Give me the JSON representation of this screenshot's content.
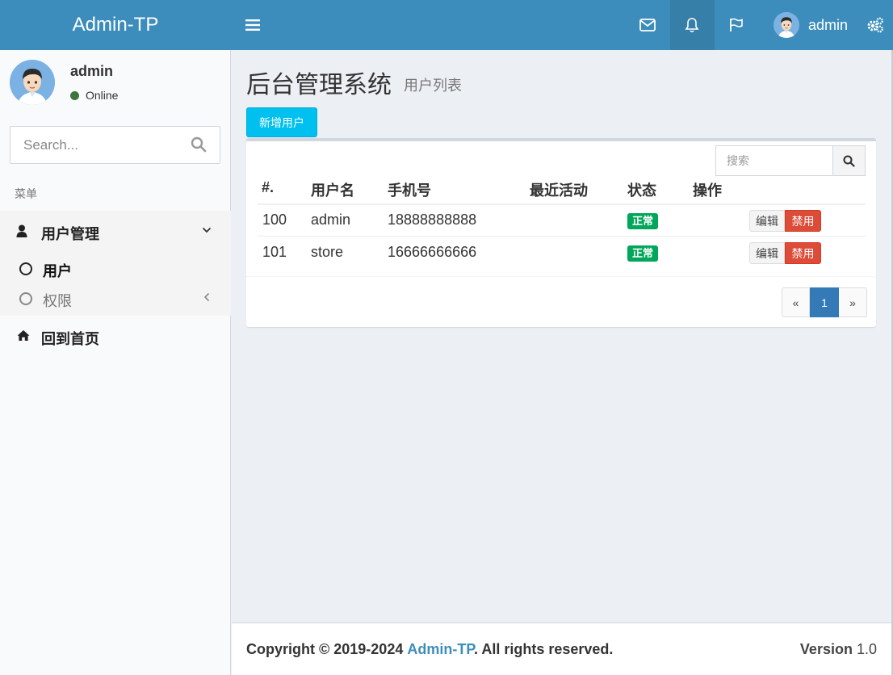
{
  "header": {
    "logo": "Admin-TP",
    "user_name": "admin"
  },
  "sidebar": {
    "user": {
      "name": "admin",
      "status": "Online"
    },
    "search_placeholder": "Search...",
    "menu_header": "菜单",
    "groups": [
      {
        "label": "用户管理",
        "items": [
          {
            "label": "用户"
          },
          {
            "label": "权限"
          }
        ]
      }
    ],
    "home_label": "回到首页"
  },
  "main": {
    "title": "后台管理系统",
    "subtitle": "用户列表",
    "add_button": "新增用户",
    "search_placeholder": "搜索",
    "columns": [
      "#.",
      "用户名",
      "手机号",
      "最近活动",
      "状态",
      "操作"
    ],
    "rows": [
      {
        "id": "100",
        "username": "admin",
        "phone": "18888888888",
        "last_active": "",
        "status": "正常",
        "edit": "编辑",
        "disable": "禁用"
      },
      {
        "id": "101",
        "username": "store",
        "phone": "16666666666",
        "last_active": "",
        "status": "正常",
        "edit": "编辑",
        "disable": "禁用"
      }
    ],
    "pagination": {
      "prev": "«",
      "current": "1",
      "next": "»"
    }
  },
  "footer": {
    "copyright": "Copyright © 2019-2024",
    "brand": "Admin-TP",
    "rights": ". All rights reserved.",
    "version_label": "Version",
    "version": "1.0"
  },
  "colors": {
    "header": "#3c8dbc",
    "header_active": "#367fa9",
    "info_button": "#00c0ef",
    "success_badge": "#00a65a",
    "danger_button": "#dd4b39",
    "pager_active": "#337ab7"
  }
}
